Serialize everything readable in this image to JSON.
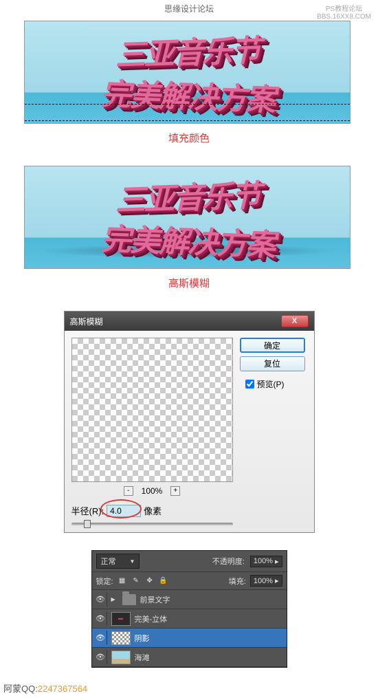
{
  "header": {
    "site": "思缘设计论坛",
    "watermark1": "PS教程论坛",
    "watermark2": "BBS.16XX8.COM"
  },
  "example1": {
    "line1": "三亚音乐节",
    "line2": "完美解决方案",
    "caption": "填充颜色"
  },
  "example2": {
    "line1": "三亚音乐节",
    "line2": "完美解决方案",
    "caption": "高斯模糊"
  },
  "dialog": {
    "title": "高斯模糊",
    "ok": "确定",
    "reset": "复位",
    "preview_label": "预览(P)",
    "zoom_pct": "100%",
    "radius_label": "半径(R):",
    "radius_value": "4.0",
    "radius_unit": "像素"
  },
  "layers": {
    "blend_mode": "正常",
    "opacity_label": "不透明度:",
    "opacity_value": "100%",
    "lock_label": "锁定:",
    "fill_label": "填充:",
    "fill_value": "100%",
    "rows": [
      {
        "name": "前景文字",
        "type": "folder"
      },
      {
        "name": "完美-立体",
        "type": "layer"
      },
      {
        "name": "阴影",
        "type": "layer",
        "selected": true
      },
      {
        "name": "海滩",
        "type": "layer"
      }
    ]
  },
  "footer": {
    "name": "阿蒙",
    "qq_label": "QQ:",
    "qq": "2247367564"
  }
}
